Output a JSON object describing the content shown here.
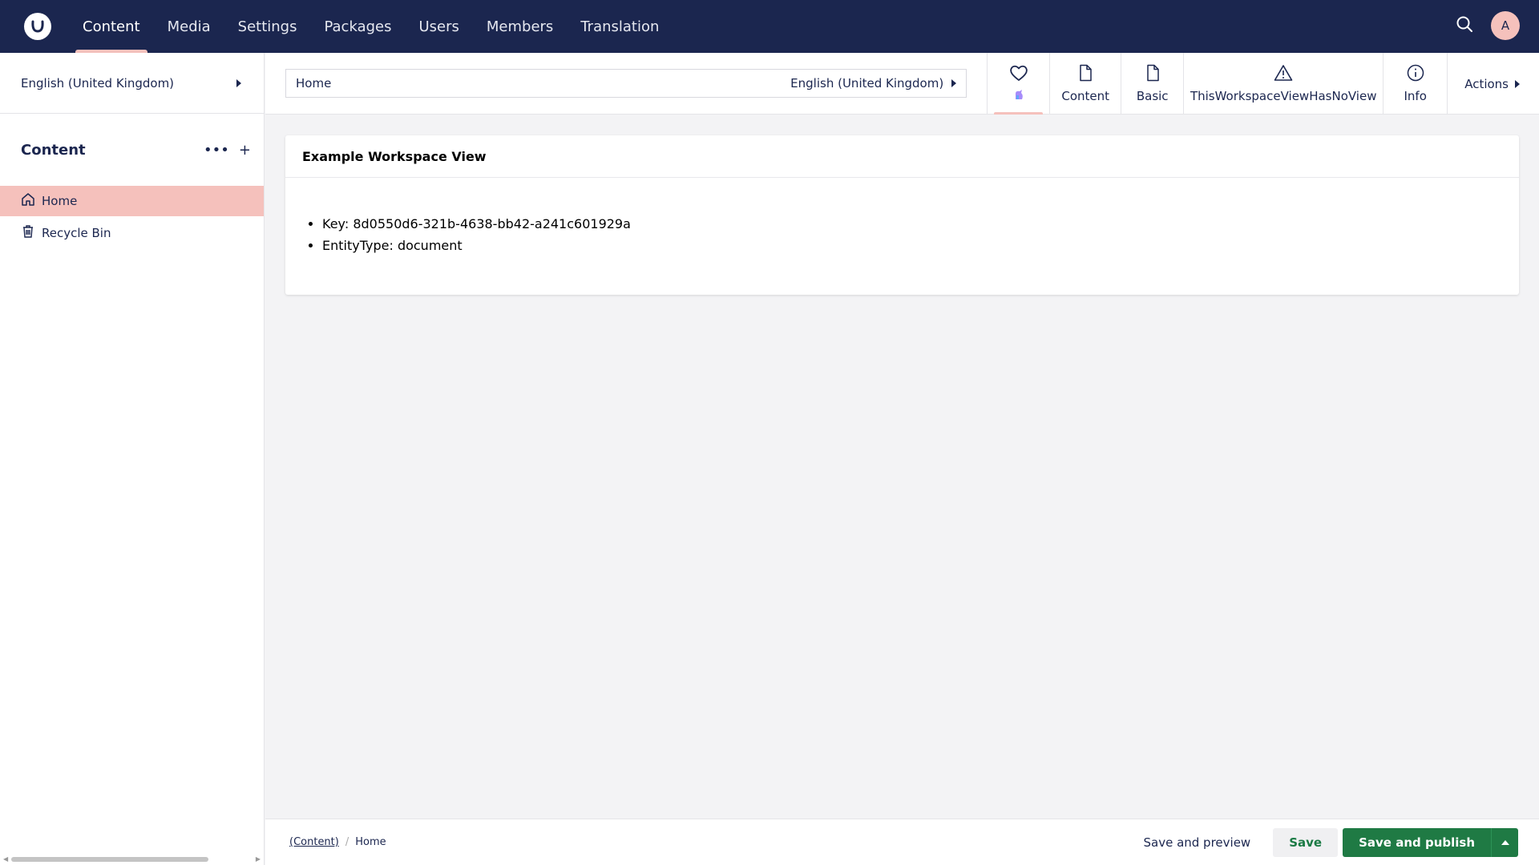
{
  "topbar": {
    "nav": [
      {
        "label": "Content",
        "active": true
      },
      {
        "label": "Media"
      },
      {
        "label": "Settings"
      },
      {
        "label": "Packages"
      },
      {
        "label": "Users"
      },
      {
        "label": "Members"
      },
      {
        "label": "Translation"
      }
    ],
    "search_icon": "search-icon",
    "avatar_initial": "A"
  },
  "sidebar": {
    "culture": "English (United Kingdom)",
    "tree_title": "Content",
    "items": [
      {
        "label": "Home",
        "icon": "home-icon",
        "active": true
      },
      {
        "label": "Recycle Bin",
        "icon": "trash-icon"
      }
    ]
  },
  "workspace": {
    "name_value": "Home",
    "variant": "English (United Kingdom)",
    "views": [
      {
        "label": "",
        "icon": "heart-icon",
        "badge": "unicorn-icon",
        "active": true
      },
      {
        "label": "Content",
        "icon": "document-icon"
      },
      {
        "label": "Basic",
        "icon": "document-icon"
      },
      {
        "label": "ThisWorkspaceViewHasNoView",
        "icon": "alert-icon"
      },
      {
        "label": "Info",
        "icon": "info-icon"
      }
    ],
    "actions_label": "Actions"
  },
  "card": {
    "title": "Example Workspace View",
    "items": [
      "Key: 8d0550d6-321b-4638-bb42-a241c601929a",
      "EntityType: document"
    ]
  },
  "footer": {
    "breadcrumb_root": "(Content)",
    "breadcrumb_separator": "/",
    "breadcrumb_current": "Home",
    "save_preview": "Save and preview",
    "save": "Save",
    "save_publish": "Save and publish"
  },
  "colors": {
    "topbar_bg": "#1b264f",
    "accent_pink": "#f5c1bc",
    "primary_green": "#1f7a44",
    "background": "#f3f3f5"
  }
}
